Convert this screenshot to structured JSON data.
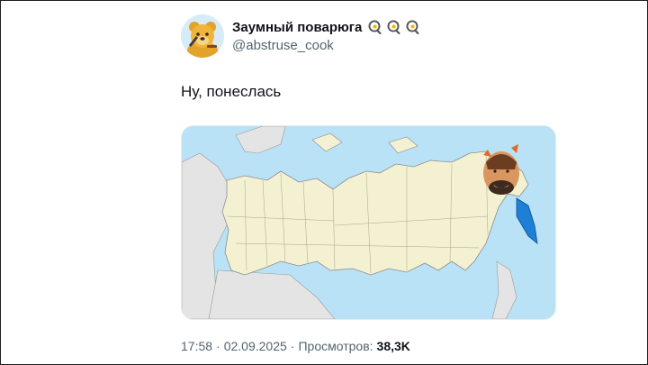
{
  "tweet": {
    "author": {
      "display_name": "Заумный поварюга",
      "handle": "@abstruse_cook",
      "name_emojis": [
        "frying-pan-egg-icon",
        "frying-pan-egg-icon",
        "frying-pan-egg-icon"
      ]
    },
    "text": "Ну, понеслась",
    "media": {
      "icon": "russia-map-with-face"
    },
    "meta": {
      "time": "17:58",
      "separator": "·",
      "date": "02.09.2025",
      "views_label": "Просмотров:",
      "views_count": "38,3K"
    }
  },
  "colors": {
    "map_sea": "#b9e2f6",
    "map_land": "#f4f1d2",
    "map_border": "#8c8c8c",
    "map_other_land": "#e4e4e4",
    "accent_blue": "#1d7fd6"
  }
}
